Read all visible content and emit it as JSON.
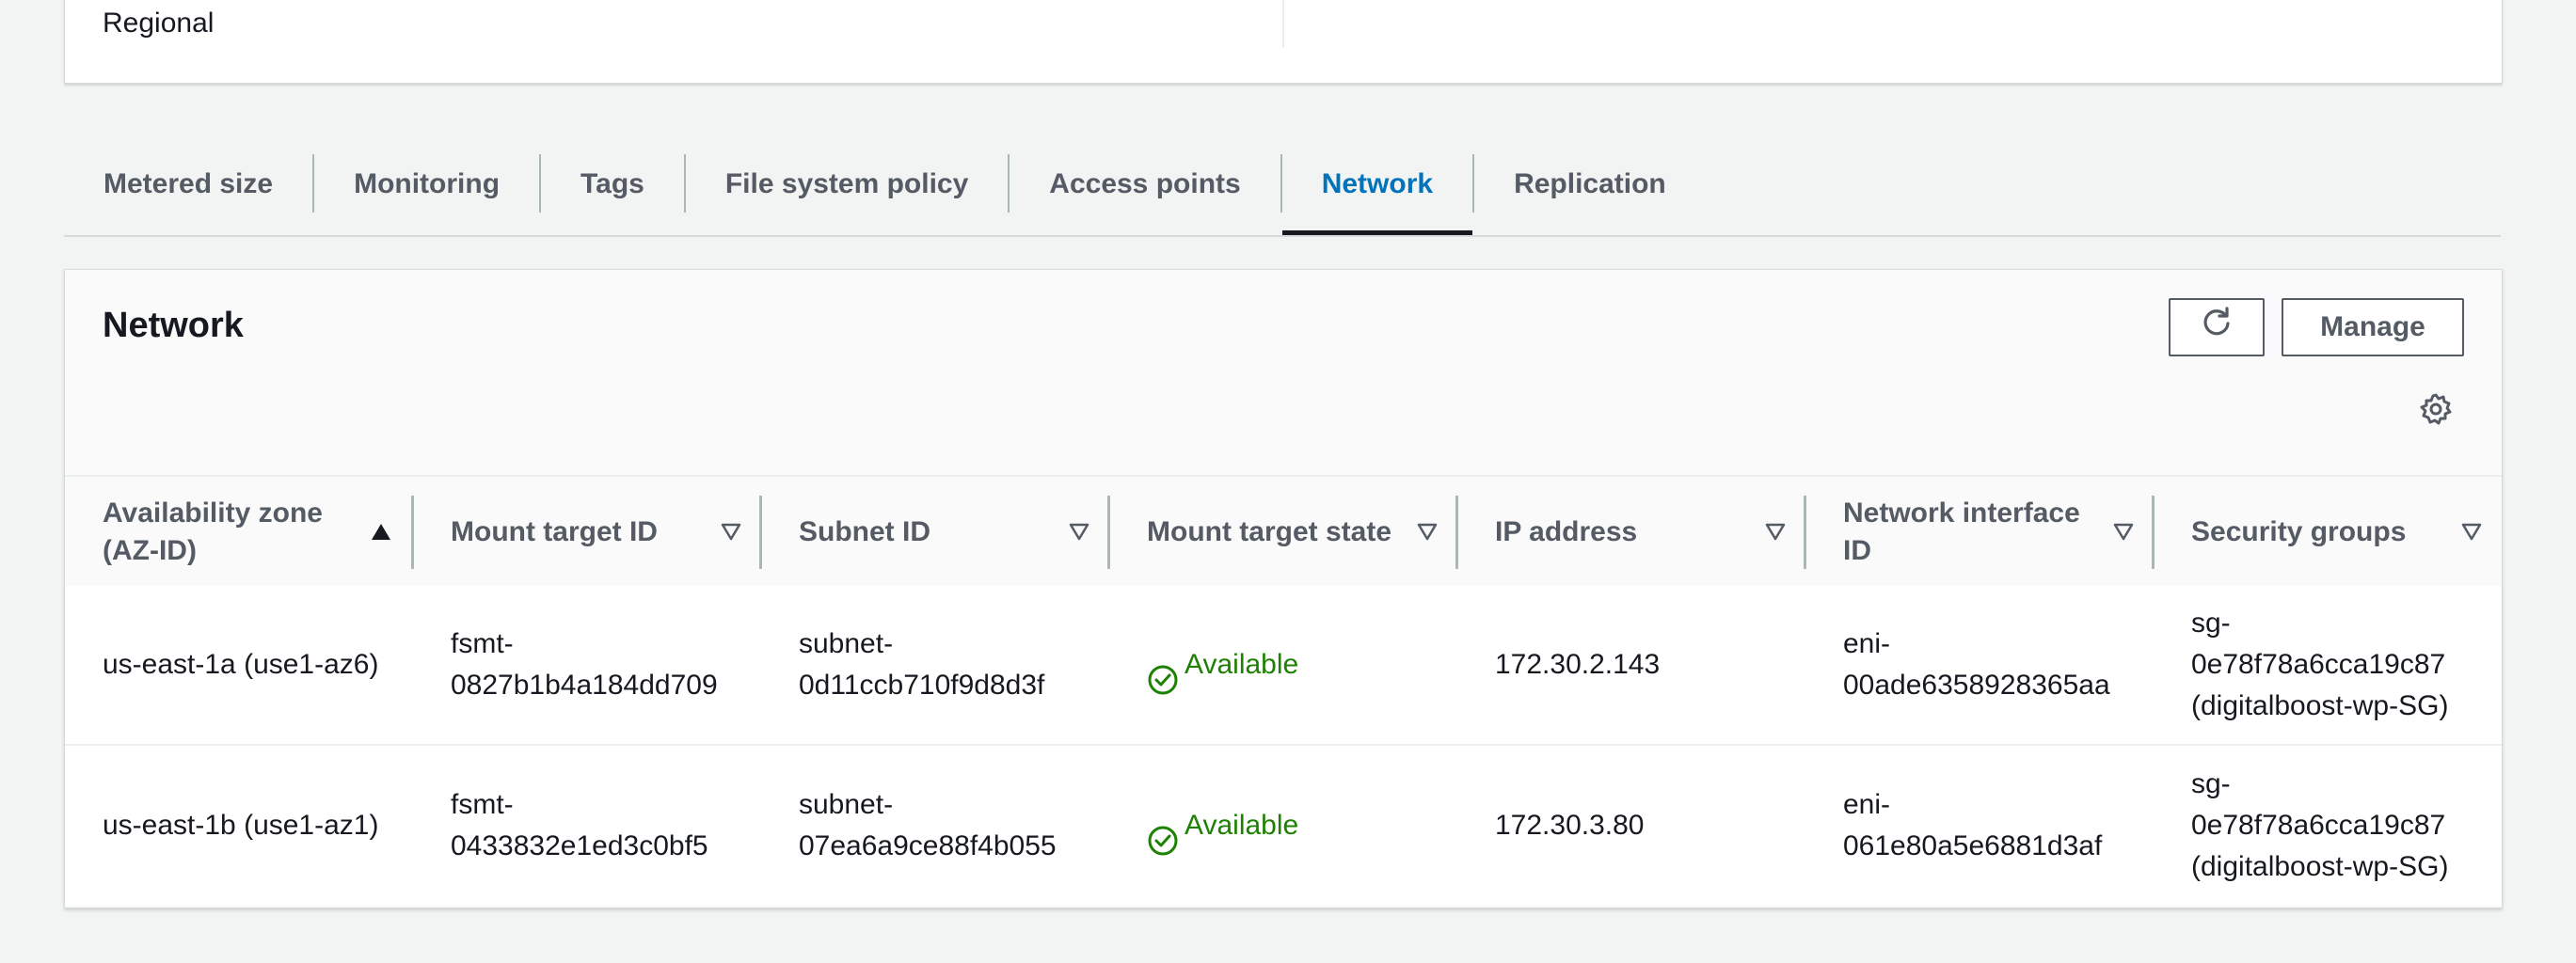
{
  "top_card": {
    "regional_label": "Regional"
  },
  "tabs": [
    {
      "label": "Metered size",
      "active": false
    },
    {
      "label": "Monitoring",
      "active": false
    },
    {
      "label": "Tags",
      "active": false
    },
    {
      "label": "File system policy",
      "active": false
    },
    {
      "label": "Access points",
      "active": false
    },
    {
      "label": "Network",
      "active": true
    },
    {
      "label": "Replication",
      "active": false
    }
  ],
  "panel": {
    "title": "Network",
    "refresh_icon": "refresh-icon",
    "manage_label": "Manage",
    "settings_icon": "gear-icon"
  },
  "table": {
    "columns": [
      {
        "label": "Availability zone\n(AZ-ID)",
        "sort": "ascending"
      },
      {
        "label": "Mount target ID",
        "sort": "none"
      },
      {
        "label": "Subnet ID",
        "sort": "none"
      },
      {
        "label": "Mount target state",
        "sort": "none"
      },
      {
        "label": "IP address",
        "sort": "none"
      },
      {
        "label": "Network interface\nID",
        "sort": "none"
      },
      {
        "label": "Security groups",
        "sort": "none"
      }
    ],
    "rows": [
      {
        "az": "us-east-1a (use1-az6)",
        "mount_target_id": "fsmt-\n0827b1b4a184dd709",
        "subnet_id": "subnet-\n0d11ccb710f9d8d3f",
        "state": "Available",
        "ip": "172.30.2.143",
        "eni": "eni-\n00ade6358928365aa",
        "security_groups": "sg-\n0e78f78a6cca19c87\n(digitalboost-wp-SG)"
      },
      {
        "az": "us-east-1b (use1-az1)",
        "mount_target_id": "fsmt-\n0433832e1ed3c0bf5",
        "subnet_id": "subnet-\n07ea6a9ce88f4b055",
        "state": "Available",
        "ip": "172.30.3.80",
        "eni": "eni-\n061e80a5e6881d3af",
        "security_groups": "sg-\n0e78f78a6cca19c87\n(digitalboost-wp-SG)"
      }
    ]
  },
  "colors": {
    "accent": "#0073bb",
    "status_available": "#1d8102",
    "background": "#f2f3f3"
  }
}
